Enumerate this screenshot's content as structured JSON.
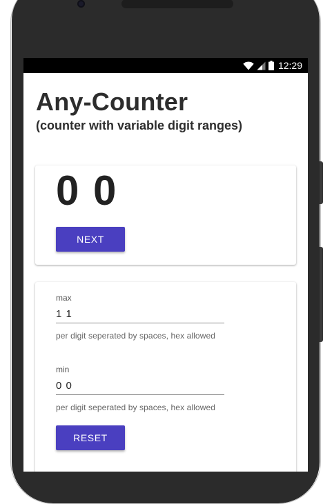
{
  "status_bar": {
    "time": "12:29",
    "icons": [
      "wifi-icon",
      "signal-icon",
      "battery-icon"
    ]
  },
  "app": {
    "title": "Any-Counter",
    "subtitle": "(counter with variable digit ranges)"
  },
  "counter": {
    "value": "0 0",
    "next_label": "NEXT"
  },
  "settings": {
    "max": {
      "label": "max",
      "value": "1 1",
      "help": "per digit seperated by spaces, hex allowed"
    },
    "min": {
      "label": "min",
      "value": "0 0",
      "help": "per digit seperated by spaces, hex allowed"
    },
    "reset_label": "RESET"
  },
  "colors": {
    "accent": "#4a3fc0",
    "status_bar": "#000000",
    "device_frame": "#2b2b2b",
    "text": "#2d2d2d"
  }
}
